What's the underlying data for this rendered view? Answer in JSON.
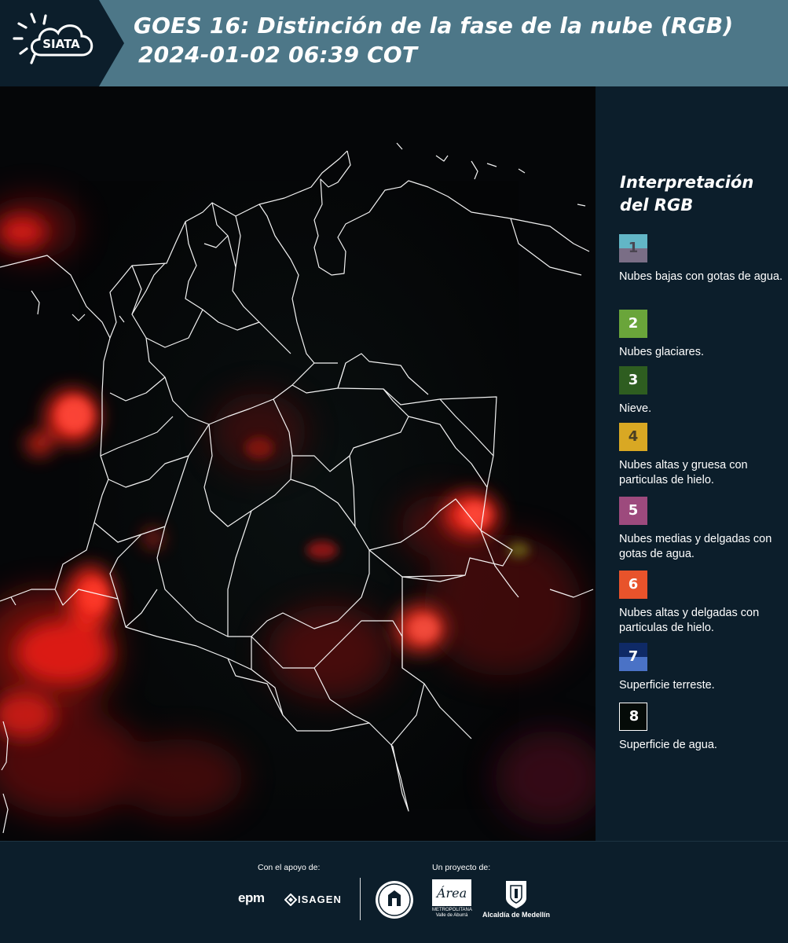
{
  "header": {
    "logo_text": "SIATA",
    "title_line1": "GOES 16: Distinción de la fase de la nube (RGB)",
    "title_line2": "2024-01-02 06:39 COT"
  },
  "legend": {
    "title": "Interpretación del RGB",
    "items": [
      {
        "num": "1",
        "label": "Nubes bajas con gotas de agua.",
        "top_color": "#62b6c6",
        "bottom_color": "#7a6e86",
        "num_color": "#4a4550"
      },
      {
        "num": "2",
        "label": "Nubes glaciares.",
        "top_color": "#6aa53a",
        "bottom_color": "#6aa53a",
        "num_color": "#ffffff"
      },
      {
        "num": "3",
        "label": "Nieve.",
        "top_color": "#2e5d20",
        "bottom_color": "#2e5d20",
        "num_color": "#ffffff"
      },
      {
        "num": "4",
        "label": "Nubes altas y gruesa con particulas de hielo.",
        "top_color": "#d9a823",
        "bottom_color": "#d9a823",
        "num_color": "#4a3f23"
      },
      {
        "num": "5",
        "label": "Nubes medias y delgadas con gotas de agua.",
        "top_color": "#9d4a7d",
        "bottom_color": "#9d4a7d",
        "num_color": "#ffffff"
      },
      {
        "num": "6",
        "label": "Nubes altas y delgadas con particulas de hielo.",
        "top_color": "#e8532b",
        "bottom_color": "#e8532b",
        "num_color": "#ffffff"
      },
      {
        "num": "7",
        "label": "Superficie terreste.",
        "top_color": "#0f2a66",
        "bottom_color": "#4a72c6",
        "num_color": "#ffffff"
      },
      {
        "num": "8",
        "label": "Superficie de agua.",
        "top_color": "#050b08",
        "bottom_color": "#050b08",
        "num_color": "#ffffff"
      }
    ]
  },
  "footer": {
    "support_caption": "Con el apoyo de:",
    "project_caption": "Un proyecto de:",
    "epm": "epm",
    "isagen": "ISAGEN",
    "area_metropolitana": "METROPOLITANA Valle de Aburrá",
    "area_script": "Área",
    "alcaldia": "Alcaldía de Medellín"
  },
  "colors": {
    "header_bg": "#4d7788",
    "logo_panel_bg": "#0c1e2b",
    "panel_bg": "#0c1e2b",
    "map_bg": "#050608",
    "cloud_red": "#ff2a1a",
    "border_line": "#ffffff"
  }
}
